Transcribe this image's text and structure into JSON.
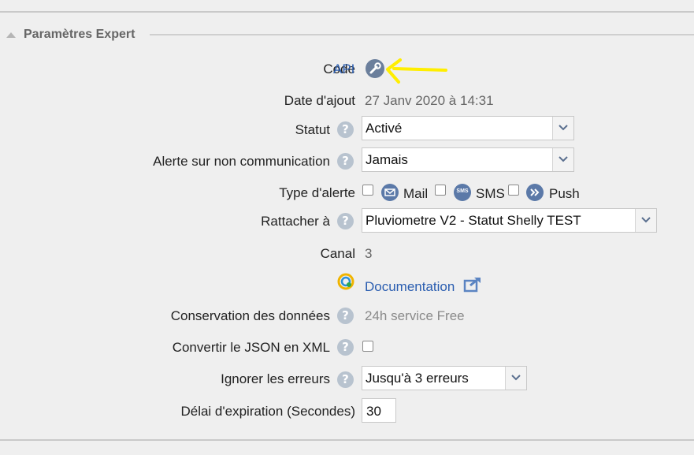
{
  "section": {
    "title": "Paramètres Expert"
  },
  "code": {
    "label": "Code",
    "link": "API"
  },
  "date_ajout": {
    "label": "Date d'ajout",
    "value": "27 Janv 2020 à 14:31"
  },
  "statut": {
    "label": "Statut",
    "selected": "Activé"
  },
  "alerte": {
    "label": "Alerte sur non communication",
    "selected": "Jamais"
  },
  "type_alerte": {
    "label": "Type d'alerte",
    "mail": "Mail",
    "sms": "SMS",
    "sms_icon_text": "SMS",
    "push": "Push"
  },
  "rattacher": {
    "label": "Rattacher à",
    "selected": "Pluviometre V2 - Statut Shelly TEST"
  },
  "canal": {
    "label": "Canal",
    "value": "3"
  },
  "documentation": {
    "link": "Documentation"
  },
  "conservation": {
    "label": "Conservation des données",
    "value": "24h service Free"
  },
  "convertir": {
    "label": "Convertir le JSON en XML"
  },
  "ignorer": {
    "label": "Ignorer les erreurs",
    "selected": "Jusqu'à 3 erreurs"
  },
  "delai": {
    "label": "Délai d'expiration (Secondes)",
    "value": "30"
  },
  "help_symbol": "?",
  "colors": {
    "link": "#2a5db0",
    "help_icon": "#b8c3cf",
    "annotation": "#ffee00"
  }
}
